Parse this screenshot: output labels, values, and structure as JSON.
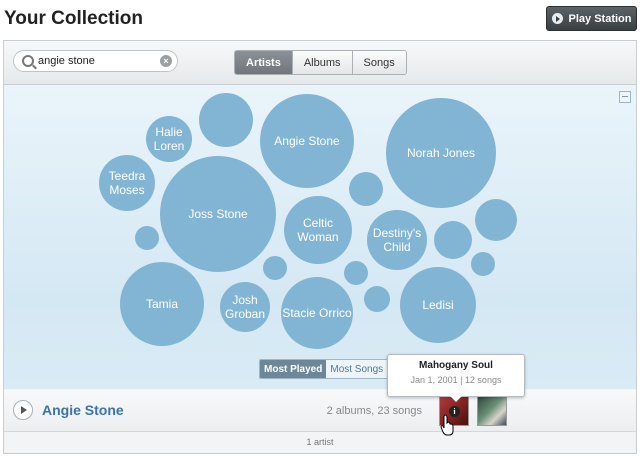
{
  "header": {
    "title": "Your Collection",
    "play_station_label": "Play Station"
  },
  "search": {
    "value": "angie stone",
    "placeholder": ""
  },
  "tabs": [
    {
      "label": "Artists",
      "active": true
    },
    {
      "label": "Albums",
      "active": false
    },
    {
      "label": "Songs",
      "active": false
    }
  ],
  "bubbles": [
    {
      "label": "Halie Loren"
    },
    {
      "label": ""
    },
    {
      "label": "Angie Stone"
    },
    {
      "label": "Norah Jones"
    },
    {
      "label": "Teedra Moses"
    },
    {
      "label": "Joss Stone"
    },
    {
      "label": ""
    },
    {
      "label": "Celtic Woman"
    },
    {
      "label": "Destiny's Child"
    },
    {
      "label": ""
    },
    {
      "label": ""
    },
    {
      "label": ""
    },
    {
      "label": ""
    },
    {
      "label": ""
    },
    {
      "label": "Tamia"
    },
    {
      "label": "Josh Groban"
    },
    {
      "label": "Stacie Orrico"
    },
    {
      "label": ""
    },
    {
      "label": ""
    },
    {
      "label": "Ledisi"
    }
  ],
  "sort_toggle": {
    "most_played": "Most Played",
    "most_songs": "Most Songs",
    "active": "most_played"
  },
  "tooltip": {
    "title": "Mahogany Soul",
    "subtitle": "Jan 1, 2001 | 12 songs"
  },
  "artist_row": {
    "name": "Angie Stone",
    "counts": "2 albums, 23 songs"
  },
  "footer": {
    "count_text": "1 artist"
  },
  "colors": {
    "bubble": "#82b5d3",
    "accent": "#3a74ad",
    "active_tab": "#7c8288"
  }
}
